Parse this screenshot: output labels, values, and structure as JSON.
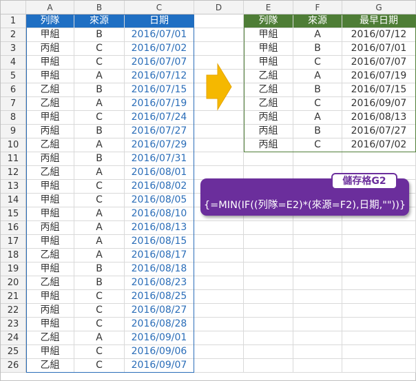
{
  "columns": [
    "A",
    "B",
    "C",
    "D",
    "E",
    "F",
    "G"
  ],
  "rows": [
    "1",
    "2",
    "3",
    "4",
    "5",
    "6",
    "7",
    "8",
    "9",
    "10",
    "11",
    "12",
    "13",
    "14",
    "15",
    "16",
    "17",
    "18",
    "19",
    "20",
    "21",
    "22",
    "23",
    "24",
    "25",
    "26"
  ],
  "left_table": {
    "headers": [
      "列隊",
      "來源",
      "日期"
    ],
    "rows": [
      [
        "甲組",
        "B",
        "2016/07/01"
      ],
      [
        "丙組",
        "C",
        "2016/07/02"
      ],
      [
        "甲組",
        "C",
        "2016/07/07"
      ],
      [
        "甲組",
        "A",
        "2016/07/12"
      ],
      [
        "乙組",
        "B",
        "2016/07/15"
      ],
      [
        "乙組",
        "A",
        "2016/07/19"
      ],
      [
        "甲組",
        "C",
        "2016/07/24"
      ],
      [
        "丙組",
        "B",
        "2016/07/27"
      ],
      [
        "乙組",
        "A",
        "2016/07/29"
      ],
      [
        "丙組",
        "B",
        "2016/07/31"
      ],
      [
        "乙組",
        "A",
        "2016/08/01"
      ],
      [
        "甲組",
        "C",
        "2016/08/02"
      ],
      [
        "甲組",
        "C",
        "2016/08/05"
      ],
      [
        "甲組",
        "A",
        "2016/08/10"
      ],
      [
        "丙組",
        "A",
        "2016/08/13"
      ],
      [
        "甲組",
        "A",
        "2016/08/15"
      ],
      [
        "乙組",
        "A",
        "2016/08/17"
      ],
      [
        "甲組",
        "B",
        "2016/08/18"
      ],
      [
        "乙組",
        "B",
        "2016/08/23"
      ],
      [
        "甲組",
        "C",
        "2016/08/25"
      ],
      [
        "丙組",
        "C",
        "2016/08/27"
      ],
      [
        "甲組",
        "C",
        "2016/08/28"
      ],
      [
        "乙組",
        "A",
        "2016/09/01"
      ],
      [
        "甲組",
        "C",
        "2016/09/06"
      ],
      [
        "乙組",
        "C",
        "2016/09/07"
      ]
    ]
  },
  "right_table": {
    "headers": [
      "列隊",
      "來源",
      "最早日期"
    ],
    "rows": [
      [
        "甲組",
        "A",
        "2016/07/12"
      ],
      [
        "甲組",
        "B",
        "2016/07/01"
      ],
      [
        "甲組",
        "C",
        "2016/07/07"
      ],
      [
        "乙組",
        "A",
        "2016/07/19"
      ],
      [
        "乙組",
        "B",
        "2016/07/15"
      ],
      [
        "乙組",
        "C",
        "2016/09/07"
      ],
      [
        "丙組",
        "A",
        "2016/08/13"
      ],
      [
        "丙組",
        "B",
        "2016/07/27"
      ],
      [
        "丙組",
        "C",
        "2016/07/02"
      ]
    ]
  },
  "callout": {
    "label": "儲存格G2",
    "formula": "{=MIN(IF((列隊=E2)*(來源=F2),日期,\"\"))}"
  },
  "colors": {
    "left_header": "#1f6fc3",
    "right_header": "#4e7d36",
    "callout": "#6b2e9c",
    "arrow": "#f5b800"
  }
}
